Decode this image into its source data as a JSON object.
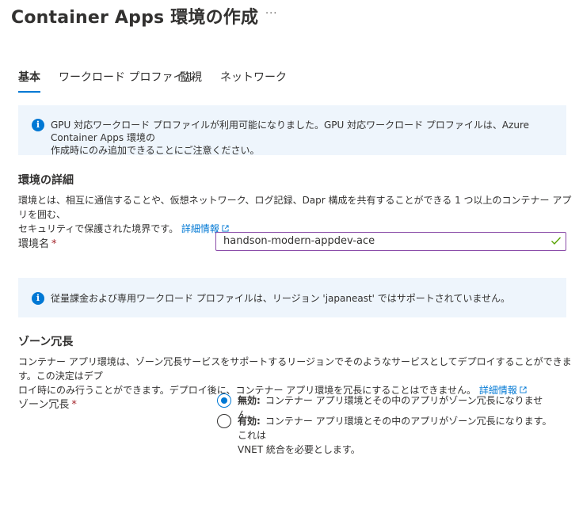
{
  "header": {
    "title": "Container Apps 環境の作成",
    "more_label": "···"
  },
  "tabs": [
    {
      "label": "基本",
      "active": true
    },
    {
      "label": "ワークロード プロファイル",
      "active": false
    },
    {
      "label": "監視",
      "active": false
    },
    {
      "label": "ネットワーク",
      "active": false
    }
  ],
  "gpu_notice": {
    "icon": "info-icon",
    "line1": "GPU 対応ワークロード プロファイルが利用可能になりました。GPU 対応ワークロード プロファイルは、Azure Container Apps 環境の",
    "line2": "作成時にのみ追加できることにご注意ください。"
  },
  "environment_details": {
    "heading": "環境の詳細",
    "desc_line1": "環境とは、相互に通信することや、仮想ネットワーク、ログ記録、Dapr 構成を共有することができる 1 つ以上のコンテナー アプリを囲む、",
    "desc_line2": "セキュリティで保護された境界です。",
    "learn_more": "詳細情報",
    "name_label": "環境名",
    "required_mark": "*",
    "name_value": "handson-modern-appdev-ace"
  },
  "region_notice": {
    "icon": "info-icon",
    "text": "従量課金および専用ワークロード プロファイルは、リージョン 'japaneast' ではサポートされていません。"
  },
  "zone_redundancy": {
    "heading": "ゾーン冗長",
    "desc_line1": "コンテナー アプリ環境は、ゾーン冗長サービスをサポートするリージョンでそのようなサービスとしてデプロイすることができます。この決定はデプ",
    "desc_line2": "ロイ時にのみ行うことができます。デプロイ後に、コンテナー アプリ環境を冗長にすることはできません。",
    "learn_more": "詳細情報",
    "field_label": "ゾーン冗長",
    "required_mark": "*",
    "options": [
      {
        "title": "無効:",
        "text_line1": "コンテナー アプリ環境とその中のアプリがゾーン冗長になりません。",
        "text_line2": "",
        "selected": true
      },
      {
        "title": "有効:",
        "text_line1": "コンテナー アプリ環境とその中のアプリがゾーン冗長になります。これは",
        "text_line2": "VNET 統合を必要とします。",
        "selected": false
      }
    ]
  },
  "colors": {
    "accent": "#0078d4",
    "info_bg": "#eef5fc",
    "input_border": "#8a4ca8",
    "valid_check": "#57a300",
    "required": "#a4262c"
  }
}
